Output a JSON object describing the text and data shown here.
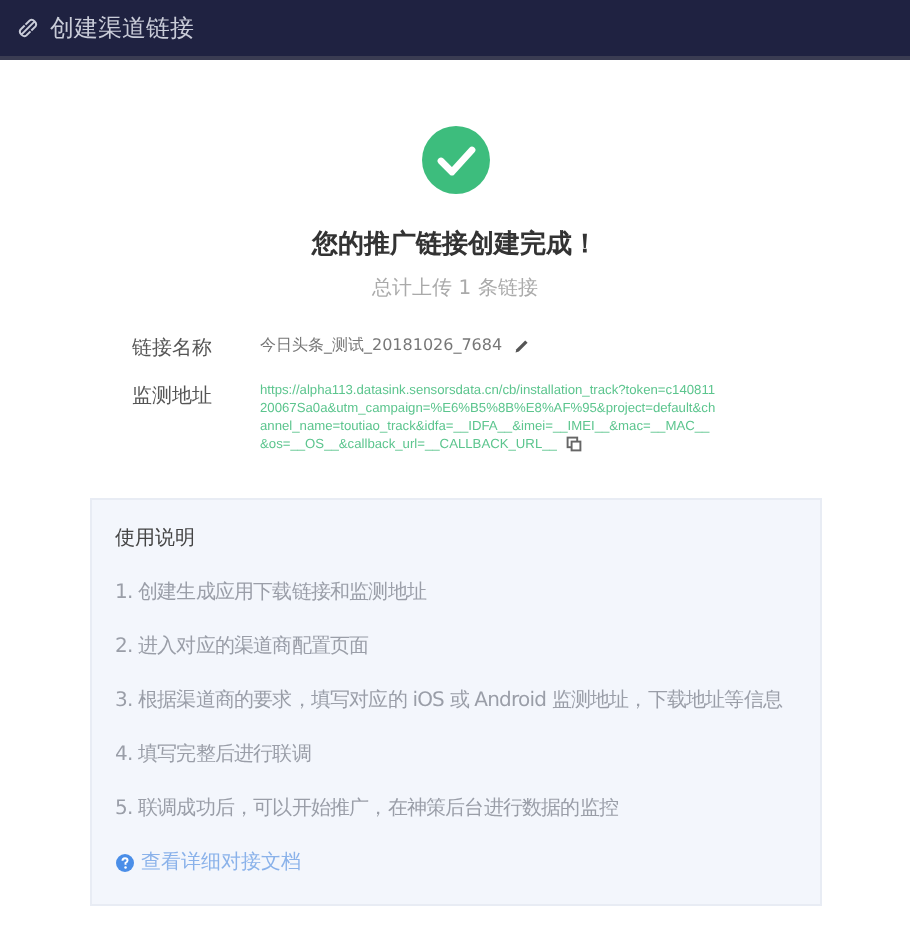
{
  "header": {
    "title": "创建渠道链接"
  },
  "result": {
    "title": "您的推广链接创建完成！",
    "subtitle": "总计上传 1 条链接"
  },
  "fields": [
    {
      "label": "链接名称",
      "value": "今日头条_测试_20181026_7684",
      "kind": "editable"
    },
    {
      "label": "监测地址",
      "value": "https://alpha113.datasink.sensorsdata.cn/cb/installation_track?token=c14081120067Sa0a&utm_campaign=%E6%B5%8B%E8%AF%95&project=default&channel_name=toutiao_track&idfa=__IDFA__&imei=__IMEI__&mac=__MAC__&os=__OS__&callback_url=__CALLBACK_URL__",
      "kind": "copyable"
    }
  ],
  "instructions": {
    "title": "使用说明",
    "steps": [
      "1. 创建生成应用下载链接和监测地址",
      "2. 进入对应的渠道商配置页面",
      "3. 根据渠道商的要求，填写对应的 iOS 或 Android 监测地址，下载地址等信息",
      "4. 填写完整后进行联调",
      "5. 联调成功后，可以开始推广，在神策后台进行数据的监控"
    ],
    "link": "查看详细对接文档"
  }
}
